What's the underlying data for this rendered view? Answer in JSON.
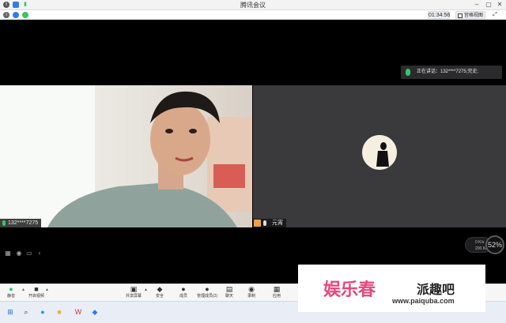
{
  "window": {
    "title": "腾讯会议"
  },
  "infobar": {
    "timer": "01:34:56",
    "view_label": "宫格视图",
    "fullscreen_label": "⤢"
  },
  "speaking": {
    "text": "正在讲话：132****7275;完史;"
  },
  "participants": [
    {
      "label": "132****7275"
    },
    {
      "label": "元宵"
    }
  ],
  "network": {
    "up": "0 K/s",
    "down": "200 K/s",
    "percent": "52%"
  },
  "toolbar": {
    "items": [
      {
        "label": "静音",
        "icon": "mic-icon"
      },
      {
        "label": "开启视频",
        "icon": "camera-icon"
      },
      {
        "label": "共享屏幕",
        "icon": "screen-share-icon"
      },
      {
        "label": "安全",
        "icon": "shield-icon"
      },
      {
        "label": "成员",
        "icon": "members-icon"
      },
      {
        "label": "管理成员(2)",
        "icon": "manage-members-icon"
      },
      {
        "label": "聊天",
        "icon": "chat-icon"
      },
      {
        "label": "录制",
        "icon": "record-icon"
      },
      {
        "label": "应用",
        "icon": "apps-icon"
      }
    ]
  },
  "watermark": {
    "logo": "娱乐春",
    "name": "派趣吧",
    "url": "www.paiquba.com"
  },
  "colors": {
    "accent_green": "#36c46e",
    "tile_gray": "#3a3a3c",
    "avatar_orange": "#f0a23a"
  }
}
